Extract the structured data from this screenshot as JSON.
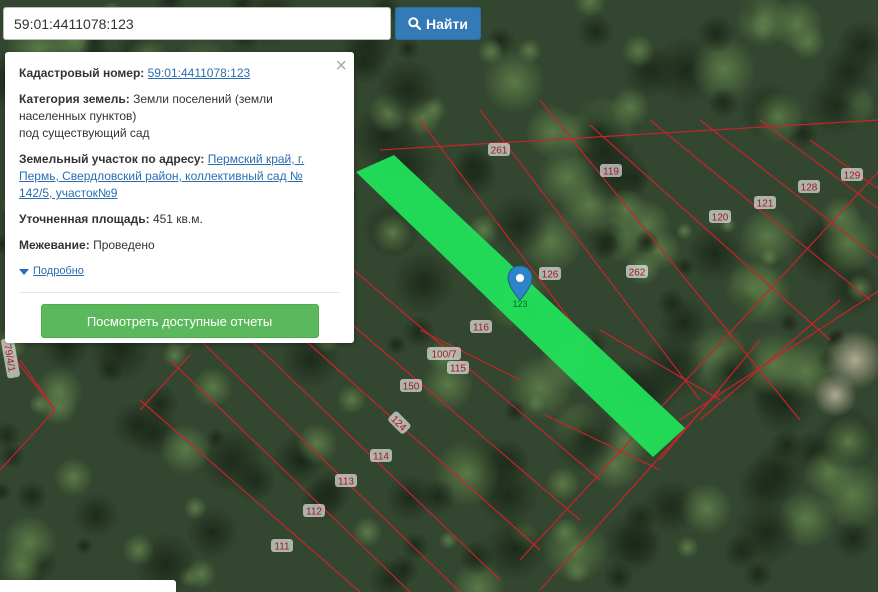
{
  "search": {
    "value": "59:01:4411078:123",
    "button_label": "Найти"
  },
  "popup": {
    "cadastral_label": "Кадастровый номер:",
    "cadastral_value": "59:01:4411078:123",
    "category_label": "Категория земель:",
    "category_value_1": "Земли поселений (земли",
    "category_value_2": "населенных пунктов)",
    "category_value_3": "под существующий сад",
    "address_label": "Земельный участок по адресу:",
    "address_value_1": "Пермский край, г.",
    "address_value_2": "Пермь, Свердловский район, коллективный сад №",
    "address_value_3": "142/5, участок№9",
    "area_label": "Уточненная площадь:",
    "area_value": "451 кв.м.",
    "survey_label": "Межевание:",
    "survey_value": "Проведено",
    "more_link": "Подробно",
    "report_button": "Посмотреть доступные отчеты",
    "close_icon": "×"
  },
  "map": {
    "highlight_color": "#22e05a",
    "boundary_color": "#c9232b",
    "marker_color": "#2d84c8",
    "marker_label": "123",
    "parcel_labels": [
      {
        "text": "261"
      },
      {
        "text": "119"
      },
      {
        "text": "128"
      },
      {
        "text": "129"
      },
      {
        "text": "121"
      },
      {
        "text": "120"
      },
      {
        "text": "262"
      },
      {
        "text": "126"
      },
      {
        "text": "116"
      },
      {
        "text": "100/7"
      },
      {
        "text": "115"
      },
      {
        "text": "150"
      },
      {
        "text": "124"
      },
      {
        "text": "114"
      },
      {
        "text": "113"
      },
      {
        "text": "112"
      },
      {
        "text": "111"
      },
      {
        "text": "79/4/1"
      }
    ]
  }
}
